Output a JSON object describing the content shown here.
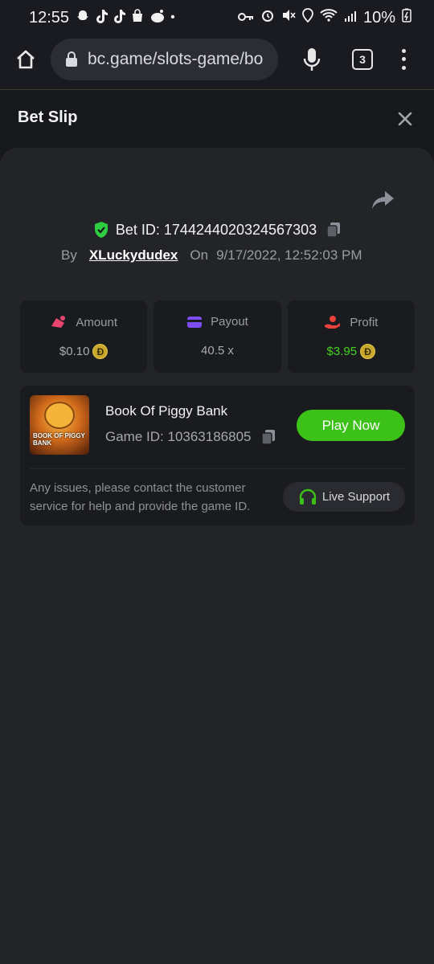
{
  "status_bar": {
    "time": "12:55",
    "battery": "10%",
    "notification_icons": [
      "snapchat-icon",
      "tiktok-icon",
      "tiktok-icon",
      "shopping-bag-icon",
      "reddit-icon"
    ],
    "system_icons": [
      "key-icon",
      "alarm-icon",
      "mute-icon",
      "location-icon",
      "wifi-icon",
      "signal-icon",
      "battery-icon"
    ]
  },
  "browser": {
    "url": "bc.game/slots-game/bo",
    "tab_count": "3"
  },
  "bet_slip": {
    "title": "Bet Slip",
    "bet_id_label": "Bet ID:",
    "bet_id": "1744244020324567303",
    "by_label": "By",
    "username": "XLuckydudex",
    "on_label": "On",
    "date": "9/17/2022, 12:52:03 PM",
    "stats": [
      {
        "label": "Amount",
        "value": "$0.10",
        "icon": "amount-icon",
        "coin": true
      },
      {
        "label": "Payout",
        "value": "40.5 x",
        "icon": "wallet-icon",
        "coin": false
      },
      {
        "label": "Profit",
        "value": "$3.95",
        "icon": "profit-icon",
        "coin": true
      }
    ],
    "coin_symbol": "Đ"
  },
  "game": {
    "name": "Book Of Piggy Bank",
    "id_label": "Game ID:",
    "id": "10363186805",
    "thumb_text": "BOOK OF PIGGY BANK",
    "play_label": "Play Now",
    "notice": "Any issues, please contact the customer service for help and provide the game ID.",
    "support_label": "Live Support"
  },
  "colors": {
    "accent_green": "#3bc117",
    "profit_green": "#43d21a",
    "shield_green": "#2ecc40",
    "amount_pink": "#e8456f",
    "payout_purple": "#7b4df2",
    "profit_red": "#e8403a",
    "coin_gold": "#c9a72a"
  }
}
